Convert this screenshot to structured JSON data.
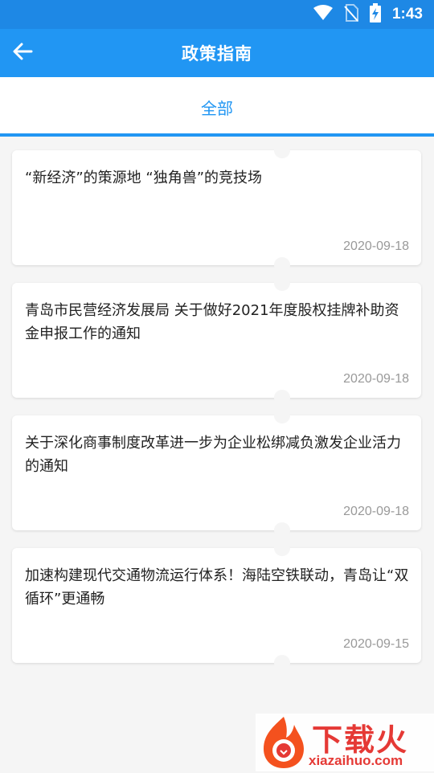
{
  "status_bar": {
    "time": "1:43"
  },
  "header": {
    "title": "政策指南"
  },
  "tabs": [
    {
      "label": "全部"
    }
  ],
  "articles": [
    {
      "title": "“新经济”的策源地 “独角兽”的竞技场",
      "date": "2020-09-18"
    },
    {
      "title": "青岛市民营经济发展局 关于做好2021年度股权挂牌补助资金申报工作的通知",
      "date": "2020-09-18"
    },
    {
      "title": "关于深化商事制度改革进一步为企业松绑减负激发企业活力的通知",
      "date": "2020-09-18"
    },
    {
      "title": "加速构建现代交通物流运行体系！海陆空铁联动，青岛让“双循环”更通畅",
      "date": "2020-09-15"
    }
  ],
  "watermark": {
    "brand": "下载火",
    "url": "xiazaihuo.com"
  },
  "colors": {
    "primary": "#2196f3",
    "status_bar": "#1e88e5",
    "brand_red": "#e53935"
  },
  "icons": [
    "wifi-icon",
    "no-sim-icon",
    "battery-charging-icon",
    "back-arrow-icon"
  ]
}
